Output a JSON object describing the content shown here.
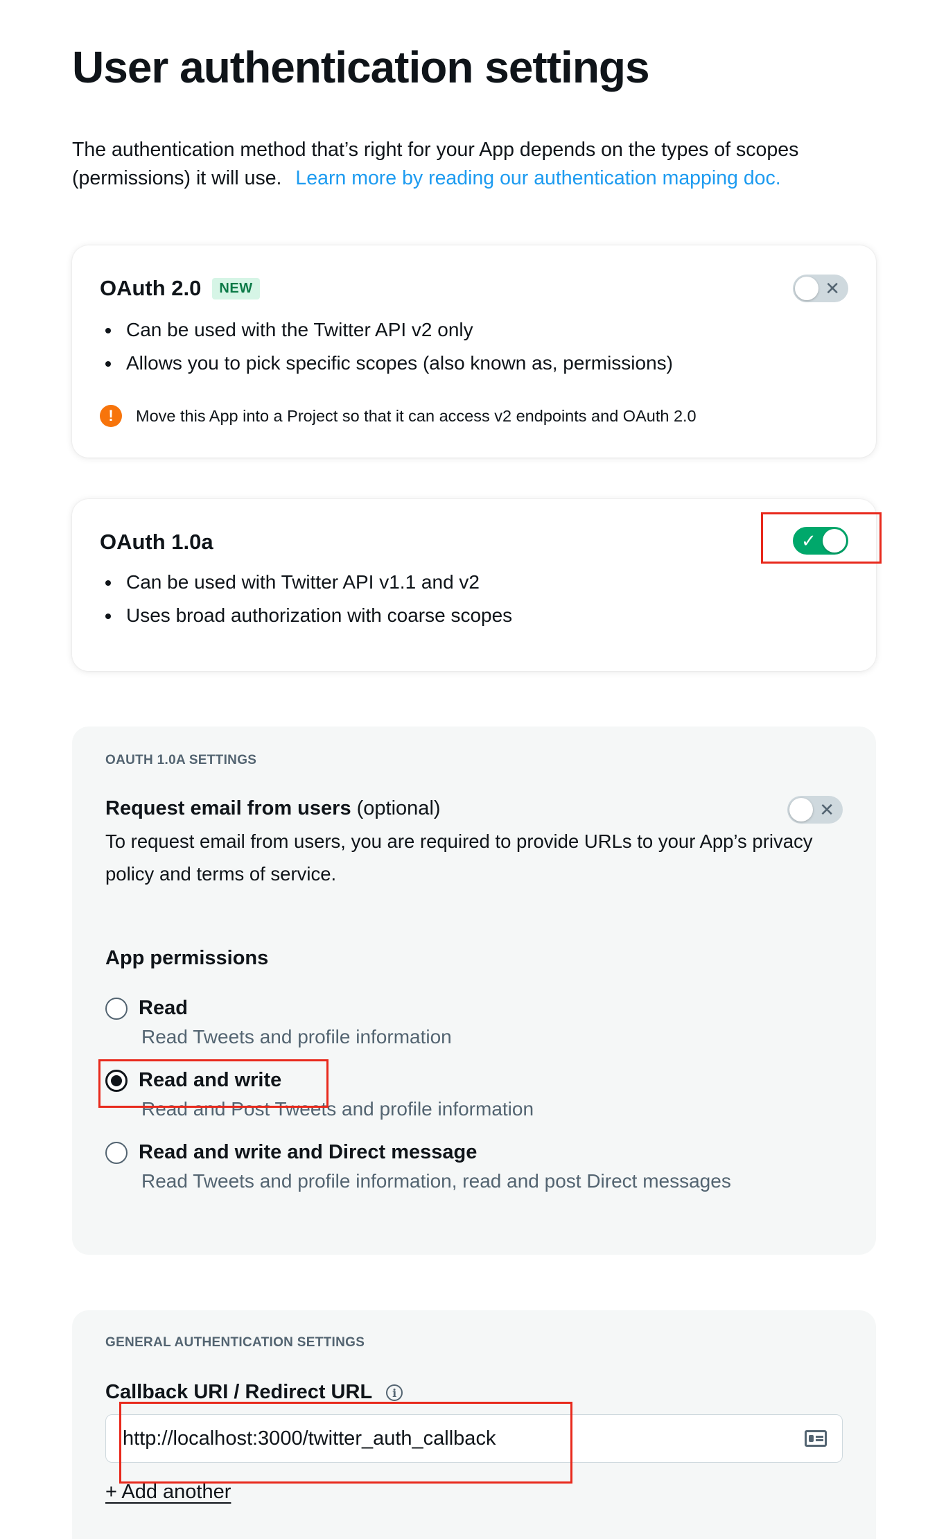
{
  "page": {
    "title": "User authentication settings",
    "intro_text": "The authentication method that’s right for your App depends on the types of scopes (permissions) it will use.",
    "intro_link": "Learn more by reading our authentication mapping doc."
  },
  "oauth2": {
    "title": "OAuth 2.0",
    "badge": "NEW",
    "enabled": false,
    "toggle_glyph": "✕",
    "bullets": [
      "Can be used with the Twitter API v2 only",
      "Allows you to pick specific scopes (also known as, permissions)"
    ],
    "notice_icon": "!",
    "notice": "Move this App into a Project so that it can access v2 endpoints and OAuth 2.0"
  },
  "oauth1": {
    "title": "OAuth 1.0a",
    "enabled": true,
    "toggle_glyph": "✓",
    "bullets": [
      "Can be used with Twitter API v1.1 and v2",
      "Uses broad authorization with coarse scopes"
    ]
  },
  "oauth1_settings": {
    "section_label": "OAUTH 1.0A SETTINGS",
    "request_email": {
      "title": "Request email from users",
      "suffix": "(optional)",
      "enabled": false,
      "toggle_glyph": "✕",
      "description": "To request email from users, you are required to provide URLs to your App’s privacy policy and terms of service."
    },
    "permissions_title": "App permissions",
    "permissions": [
      {
        "label": "Read",
        "description": "Read Tweets and profile information",
        "selected": false
      },
      {
        "label": "Read and write",
        "description": "Read and Post Tweets and profile information",
        "selected": true
      },
      {
        "label": "Read and write and Direct message",
        "description": "Read Tweets and profile information, read and post Direct messages",
        "selected": false
      }
    ]
  },
  "general_settings": {
    "section_label": "GENERAL AUTHENTICATION SETTINGS",
    "callback_label": "Callback URI / Redirect URL",
    "info_icon": "i",
    "callback_value": "http://localhost:3000/twitter_auth_callback",
    "add_another": "+ Add another"
  },
  "colors": {
    "accent_link": "#1d9bf0",
    "toggle_on": "#00a86b",
    "highlight": "#e8291c",
    "warning": "#f7740b"
  }
}
